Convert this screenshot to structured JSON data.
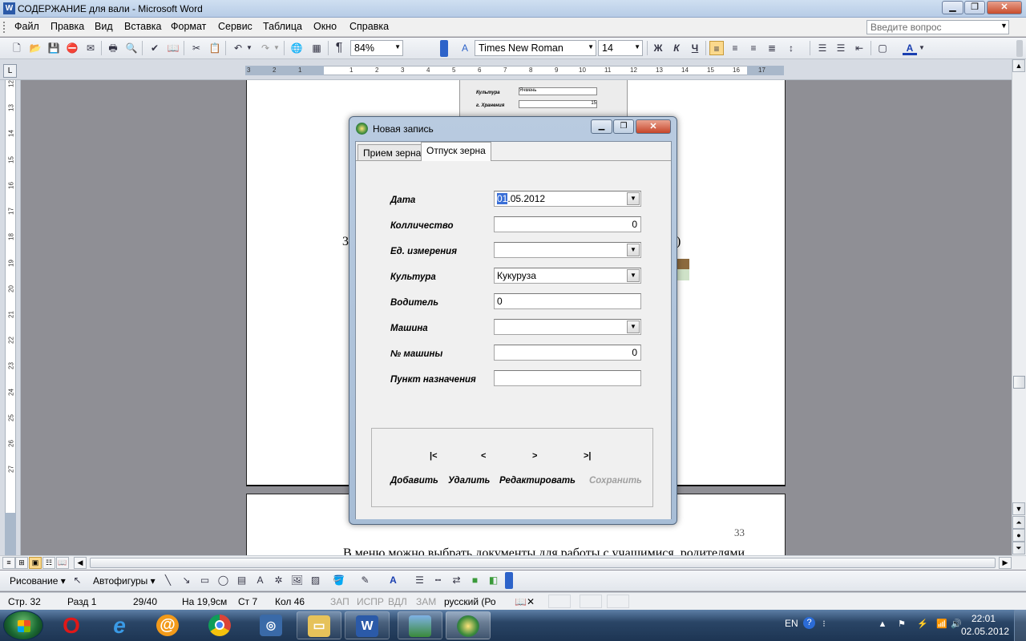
{
  "window": {
    "title": "СОДЕРЖАНИЕ для вали - Microsoft Word",
    "app_icon": "W"
  },
  "menu": {
    "items": [
      "Файл",
      "Правка",
      "Вид",
      "Вставка",
      "Формат",
      "Сервис",
      "Таблица",
      "Окно",
      "Справка"
    ],
    "help_placeholder": "Введите вопрос"
  },
  "toolbar": {
    "zoom": "84%",
    "font": "Times New Roman",
    "font_size": "14",
    "bold": "Ж",
    "italic": "К",
    "underline": "Ч",
    "pilcrow": "¶"
  },
  "ruler": {
    "h_numbers": [
      "3",
      "2",
      "1",
      "1",
      "2",
      "3",
      "4",
      "5",
      "6",
      "7",
      "8",
      "9",
      "10",
      "11",
      "12",
      "13",
      "14",
      "15",
      "16",
      "17"
    ],
    "v_numbers": [
      "12",
      "13",
      "14",
      "15",
      "16",
      "17",
      "18",
      "19",
      "20",
      "21",
      "22",
      "23",
      "24",
      "25",
      "26",
      "27"
    ]
  },
  "document": {
    "text_3": "3",
    "text_paren": "5)",
    "page_number": "33",
    "body_line": "В меню можно выбрать документы для работы с учащимися, родителями",
    "embedded": {
      "label1": "Культура",
      "value1": "Ячмень",
      "label2": "г. Хранения",
      "value2": "15"
    }
  },
  "dialog": {
    "title": "Новая запись",
    "tabs": [
      "Прием зерна",
      "Отпуск зерна"
    ],
    "selected_tab": "Отпуск зерна",
    "fields": [
      {
        "label": "Дата",
        "value_sel": "01",
        "value_rest": ".05.2012"
      },
      {
        "label": "Колличество",
        "value": "0"
      },
      {
        "label": "Ед. измерения",
        "value": ""
      },
      {
        "label": "Культура",
        "value": "Кукуруза"
      },
      {
        "label": "Водитель",
        "value": "0"
      },
      {
        "label": "Машина",
        "value": ""
      },
      {
        "label": "№ машины",
        "value": "0"
      },
      {
        "label": "Пункт назначения",
        "value": ""
      }
    ],
    "nav": {
      "first": "|<",
      "prev": "<",
      "next": ">",
      "last": ">|"
    },
    "actions": {
      "add": "Добавить",
      "delete": "Удалить",
      "edit": "Редактировать",
      "save": "Сохранить"
    }
  },
  "drawbar": {
    "drawing": "Рисование",
    "autoshapes": "Автофигуры"
  },
  "status": {
    "page": "Стр. 32",
    "section": "Разд 1",
    "pages": "29/40",
    "at": "На 19,9см",
    "line": "Ст 7",
    "col": "Кол 46",
    "rec": "ЗАП",
    "trk": "ИСПР",
    "ext": "ВДЛ",
    "ovr": "ЗАМ",
    "lang": "русский (Ро"
  },
  "taskbar": {
    "lang": "EN",
    "time": "22:01",
    "date": "02.05.2012"
  },
  "colors": {
    "taskbar": "#2a4566",
    "titlebar": "#b7cce6",
    "accent": "#3a6fd6"
  }
}
